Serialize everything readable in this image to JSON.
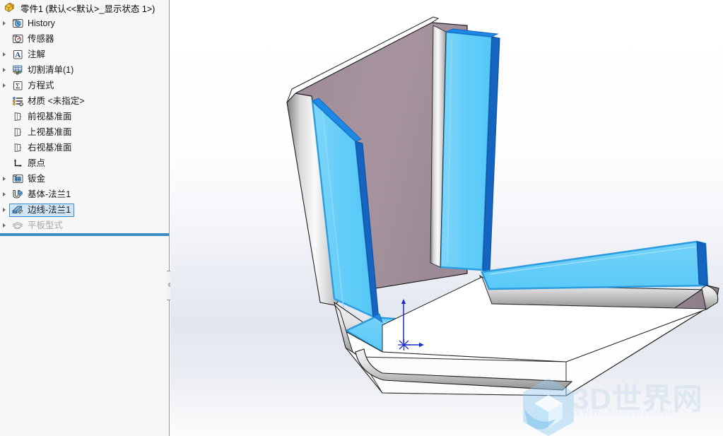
{
  "app": {
    "title": "零件1  (默认<<默认>_显示状态 1>)",
    "root_icon": "part-icon"
  },
  "tree": {
    "items": [
      {
        "label": "History",
        "icon": "history-icon",
        "expandable": true,
        "selected": false,
        "dim": false
      },
      {
        "label": "传感器",
        "icon": "sensor-icon",
        "expandable": false,
        "selected": false,
        "dim": false
      },
      {
        "label": "注解",
        "icon": "annotations-icon",
        "expandable": true,
        "selected": false,
        "dim": false
      },
      {
        "label": "切割清单(1)",
        "icon": "cutlist-icon",
        "expandable": true,
        "selected": false,
        "dim": false
      },
      {
        "label": "方程式",
        "icon": "equations-icon",
        "expandable": true,
        "selected": false,
        "dim": false
      },
      {
        "label": "材质 <未指定>",
        "icon": "material-icon",
        "expandable": false,
        "selected": false,
        "dim": false
      },
      {
        "label": "前视基准面",
        "icon": "plane-icon",
        "expandable": false,
        "selected": false,
        "dim": false
      },
      {
        "label": "上视基准面",
        "icon": "plane-icon",
        "expandable": false,
        "selected": false,
        "dim": false
      },
      {
        "label": "右视基准面",
        "icon": "plane-icon",
        "expandable": false,
        "selected": false,
        "dim": false
      },
      {
        "label": "原点",
        "icon": "origin-icon",
        "expandable": false,
        "selected": false,
        "dim": false
      },
      {
        "label": "钣金",
        "icon": "sheetmetal-icon",
        "expandable": true,
        "selected": false,
        "dim": false
      },
      {
        "label": "基体-法兰1",
        "icon": "base-flange-icon",
        "expandable": true,
        "selected": false,
        "dim": false
      },
      {
        "label": "边线-法兰1",
        "icon": "edge-flange-icon",
        "expandable": true,
        "selected": true,
        "dim": false
      },
      {
        "label": "平板型式",
        "icon": "flatpattern-icon",
        "expandable": true,
        "selected": false,
        "dim": true
      }
    ]
  },
  "viewport": {
    "origin_marker": "origin-triad",
    "colors": {
      "selected_face": "#62cdf7",
      "selected_edge": "#1565c0",
      "inner_face": "#a08f9c",
      "edge_line": "#1a1a1a",
      "background_top": "#ffffff",
      "background_mid": "#e2e6ef"
    }
  },
  "watermark": {
    "text": "3D世界网",
    "url": "www.3dsjw.com",
    "logo": "hex-cube-logo"
  }
}
